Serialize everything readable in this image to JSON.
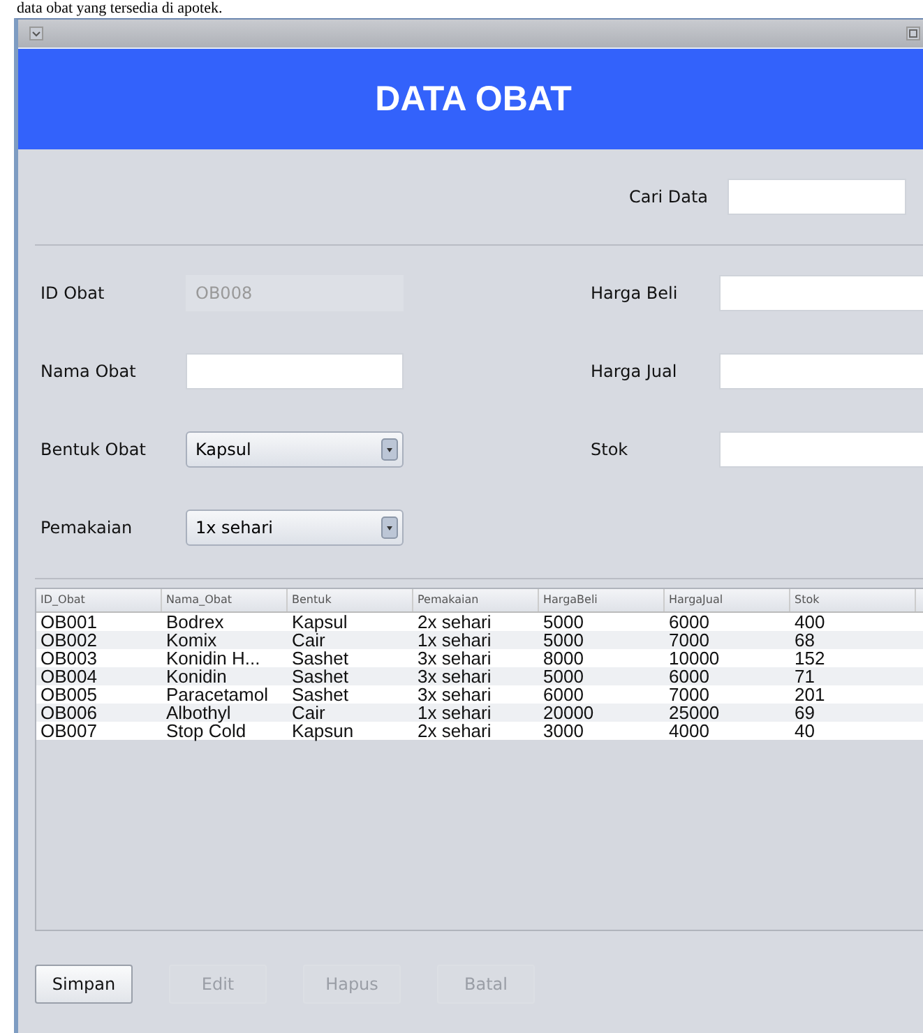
{
  "caption": "data obat yang tersedia di apotek.",
  "header": {
    "title": "DATA OBAT"
  },
  "search": {
    "label": "Cari Data"
  },
  "left_fields": [
    {
      "label": "ID Obat",
      "kind": "text",
      "value": "OB008",
      "disabled": true
    },
    {
      "label": "Nama Obat",
      "kind": "text",
      "disabled": false
    },
    {
      "label": "Bentuk Obat",
      "kind": "select",
      "value": "Kapsul",
      "disabled": false
    },
    {
      "label": "Pemakaian",
      "kind": "select",
      "value": "1x sehari",
      "disabled": false
    }
  ],
  "right_fields": [
    {
      "label": "Harga Beli"
    },
    {
      "label": "Harga Jual"
    },
    {
      "label": "Stok"
    }
  ],
  "table": {
    "columns": [
      "ID_Obat",
      "Nama_Obat",
      "Bentuk",
      "Pemakaian",
      "HargaBeli",
      "HargaJual",
      "Stok"
    ],
    "rows": [
      [
        "OB001",
        "Bodrex",
        "Kapsul",
        "2x sehari",
        "5000",
        "6000",
        "400"
      ],
      [
        "OB002",
        "Komix",
        "Cair",
        "1x sehari",
        "5000",
        "7000",
        "68"
      ],
      [
        "OB003",
        "Konidin H...",
        "Sashet",
        "3x sehari",
        "8000",
        "10000",
        "152"
      ],
      [
        "OB004",
        "Konidin",
        "Sashet",
        "3x sehari",
        "5000",
        "6000",
        "71"
      ],
      [
        "OB005",
        "Paracetamol",
        "Sashet",
        "3x sehari",
        "6000",
        "7000",
        "201"
      ],
      [
        "OB006",
        "Albothyl",
        "Cair",
        "1x sehari",
        "20000",
        "25000",
        "69"
      ],
      [
        "OB007",
        "Stop Cold",
        "Kapsun",
        "2x sehari",
        "3000",
        "4000",
        "40"
      ]
    ]
  },
  "buttons": [
    {
      "label": "Simpan",
      "disabled": false
    },
    {
      "label": "Edit",
      "disabled": true
    },
    {
      "label": "Hapus",
      "disabled": true
    },
    {
      "label": "Batal",
      "disabled": true
    }
  ]
}
